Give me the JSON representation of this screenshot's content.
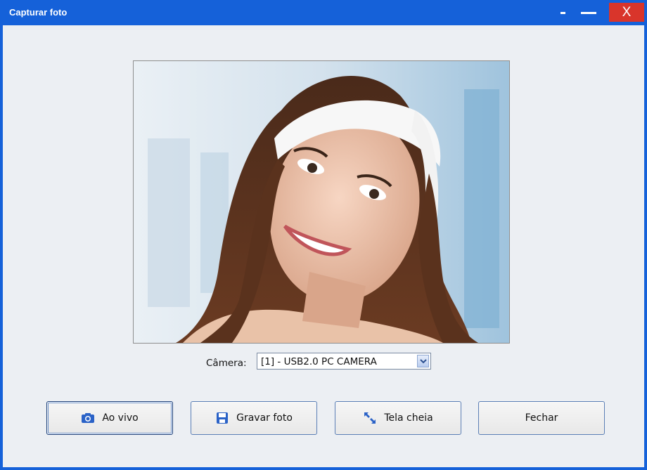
{
  "window": {
    "title": "Capturar foto",
    "close_label": "X",
    "accent": "#1561d9",
    "close_color": "#d9352b"
  },
  "camera": {
    "label": "Câmera:",
    "selected": "[1] - USB2.0 PC CAMERA"
  },
  "buttons": {
    "live": "Ao vivo",
    "save": "Gravar foto",
    "fullscreen": "Tela cheia",
    "close": "Fechar"
  }
}
